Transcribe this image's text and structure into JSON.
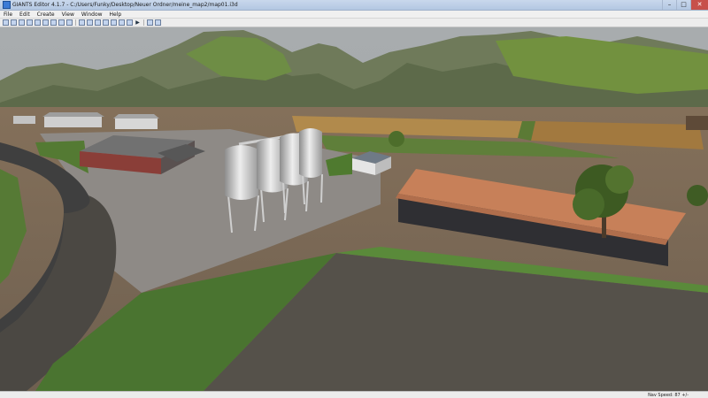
{
  "window": {
    "title": "GIANTS Editor 4.1.7 - C:/Users/Funky/Desktop/Neuer Ordner/meine_map2/map01.i3d",
    "controls": {
      "minimize": "–",
      "maximize": "□",
      "close": "✕"
    }
  },
  "menu": {
    "items": [
      {
        "label": "File"
      },
      {
        "label": "Edit"
      },
      {
        "label": "Create"
      },
      {
        "label": "View"
      },
      {
        "label": "Window"
      },
      {
        "label": "Help"
      }
    ]
  },
  "toolbar": {
    "play_glyph": "▶"
  },
  "status": {
    "nav_speed": "Nav Speed: 87 +/-"
  },
  "colors": {
    "sky": "#a3a8ab",
    "grass": "#5f8a3b",
    "dirt": "#8a7047",
    "field_plowed": "#545048",
    "silo": "#d9d9d9",
    "roof": "#c9805a"
  }
}
